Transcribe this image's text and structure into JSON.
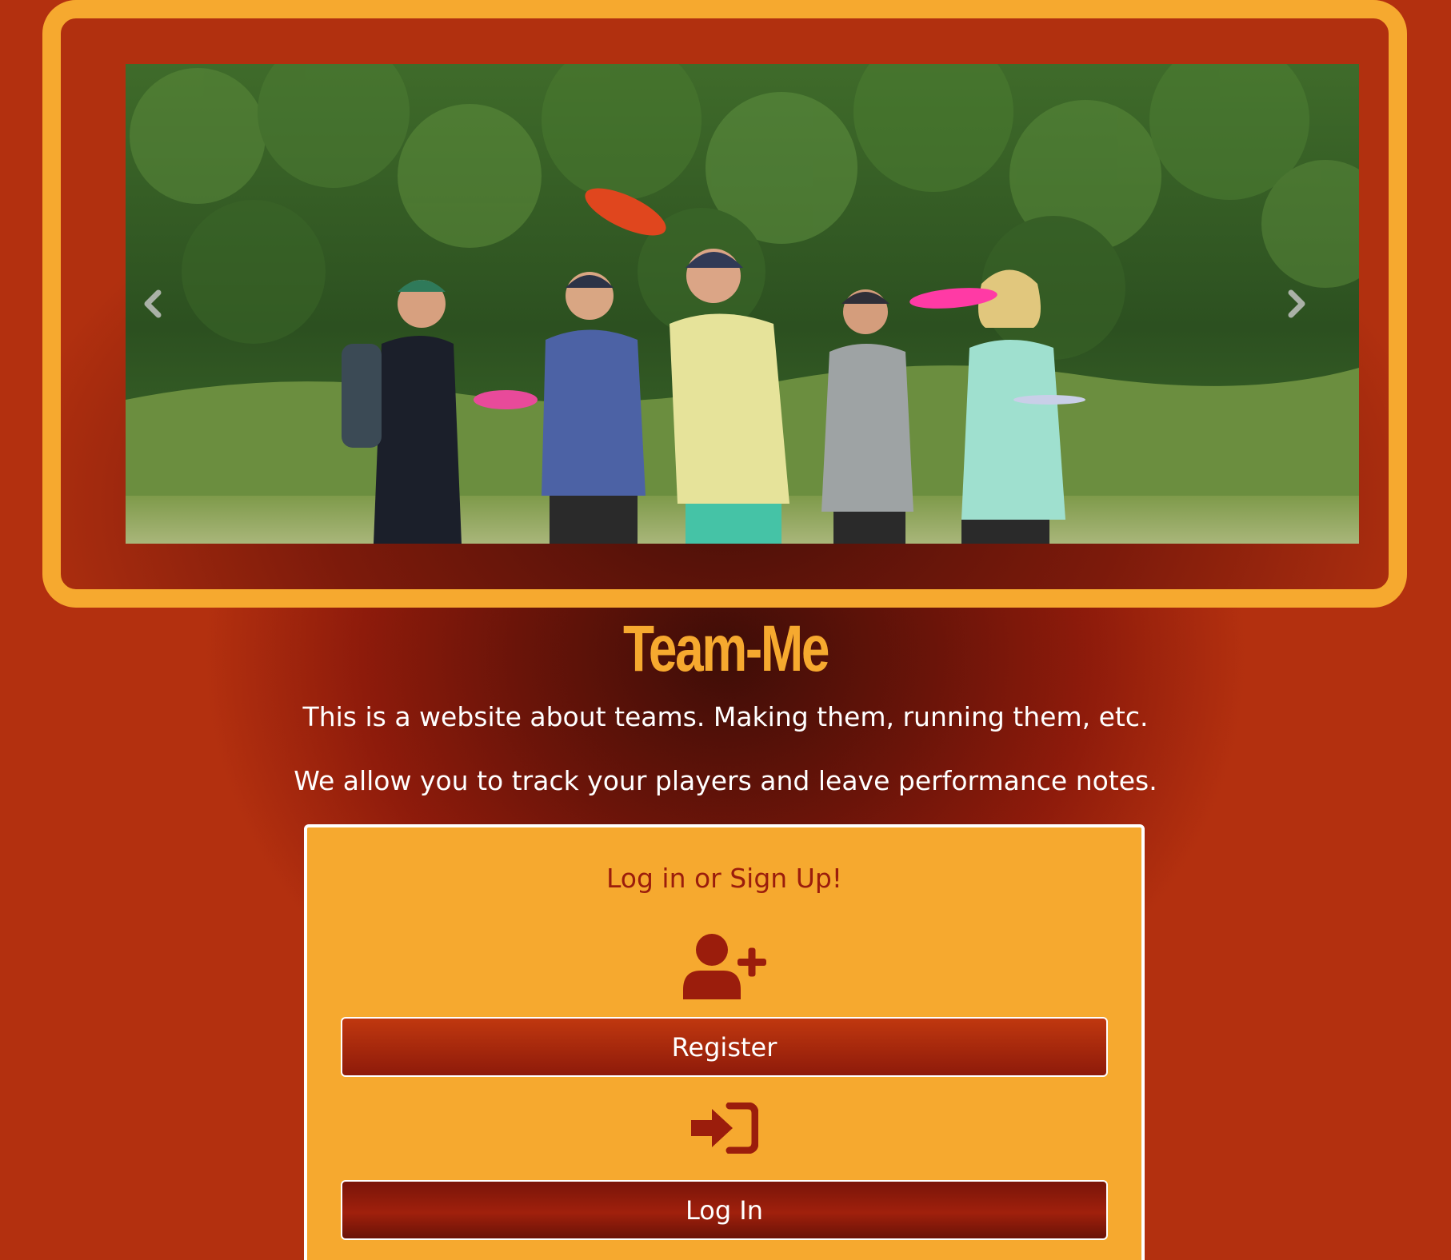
{
  "carousel": {
    "prev_icon": "chevron-left-icon",
    "next_icon": "chevron-right-icon",
    "frame_color": "#f6a92f"
  },
  "site": {
    "title": "Team-Me",
    "intro_line_1": "This is a website about teams. Making them, running them, etc.",
    "intro_line_2": "We allow you to track your players and leave performance notes."
  },
  "auth": {
    "heading": "Log in or Sign Up!",
    "register_icon": "user-plus-icon",
    "register_label": "Register",
    "login_icon": "sign-in-icon",
    "login_label": "Log In"
  },
  "colors": {
    "accent": "#f6a92f",
    "brand_dark": "#9b1d0c"
  }
}
